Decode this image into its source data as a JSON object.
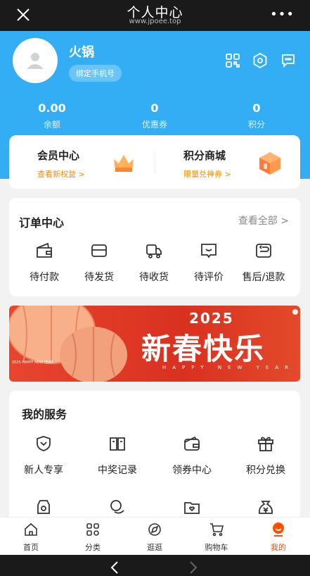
{
  "header": {
    "title": "个人中心",
    "subtitle": "www.jpoee.top",
    "more": "•••"
  },
  "user": {
    "name": "火锅",
    "bind_phone": "绑定手机号"
  },
  "stats": [
    {
      "value": "0.00",
      "label": "余额"
    },
    {
      "value": "0",
      "label": "优惠券"
    },
    {
      "value": "0",
      "label": "积分"
    }
  ],
  "vip": {
    "member": {
      "title": "会员中心",
      "sub": "查看新权益 >"
    },
    "mall": {
      "title": "积分商城",
      "sub": "限量兑神券 >"
    }
  },
  "orders": {
    "title": "订单中心",
    "view_all": "查看全部 >",
    "items": [
      {
        "label": "待付款",
        "icon": "wallet-icon"
      },
      {
        "label": "待发货",
        "icon": "card-icon"
      },
      {
        "label": "待收货",
        "icon": "truck-icon"
      },
      {
        "label": "待评价",
        "icon": "comment-icon"
      },
      {
        "label": "售后/退款",
        "icon": "refund-icon"
      }
    ]
  },
  "banner": {
    "year": "2025",
    "text": "新春快乐",
    "sub": "HAPPY NEW YEAR",
    "small": "2025 HAPPY NEW YEAR"
  },
  "services": {
    "title": "我的服务",
    "items": [
      {
        "label": "新人专享",
        "icon": "shield-heart-icon"
      },
      {
        "label": "中奖记录",
        "icon": "book-icon"
      },
      {
        "label": "领券中心",
        "icon": "coupon-wallet-icon"
      },
      {
        "label": "积分兑换",
        "icon": "gift-icon"
      }
    ]
  },
  "tabbar": [
    {
      "label": "首页",
      "icon": "home-icon"
    },
    {
      "label": "分类",
      "icon": "grid-icon"
    },
    {
      "label": "逛逛",
      "icon": "compass-icon"
    },
    {
      "label": "购物车",
      "icon": "cart-icon"
    },
    {
      "label": "我的",
      "icon": "profile-icon",
      "active": true
    }
  ],
  "colors": {
    "brand": "#33aef4",
    "accent": "#ff8a00",
    "active_tab": "#ff4d00"
  }
}
